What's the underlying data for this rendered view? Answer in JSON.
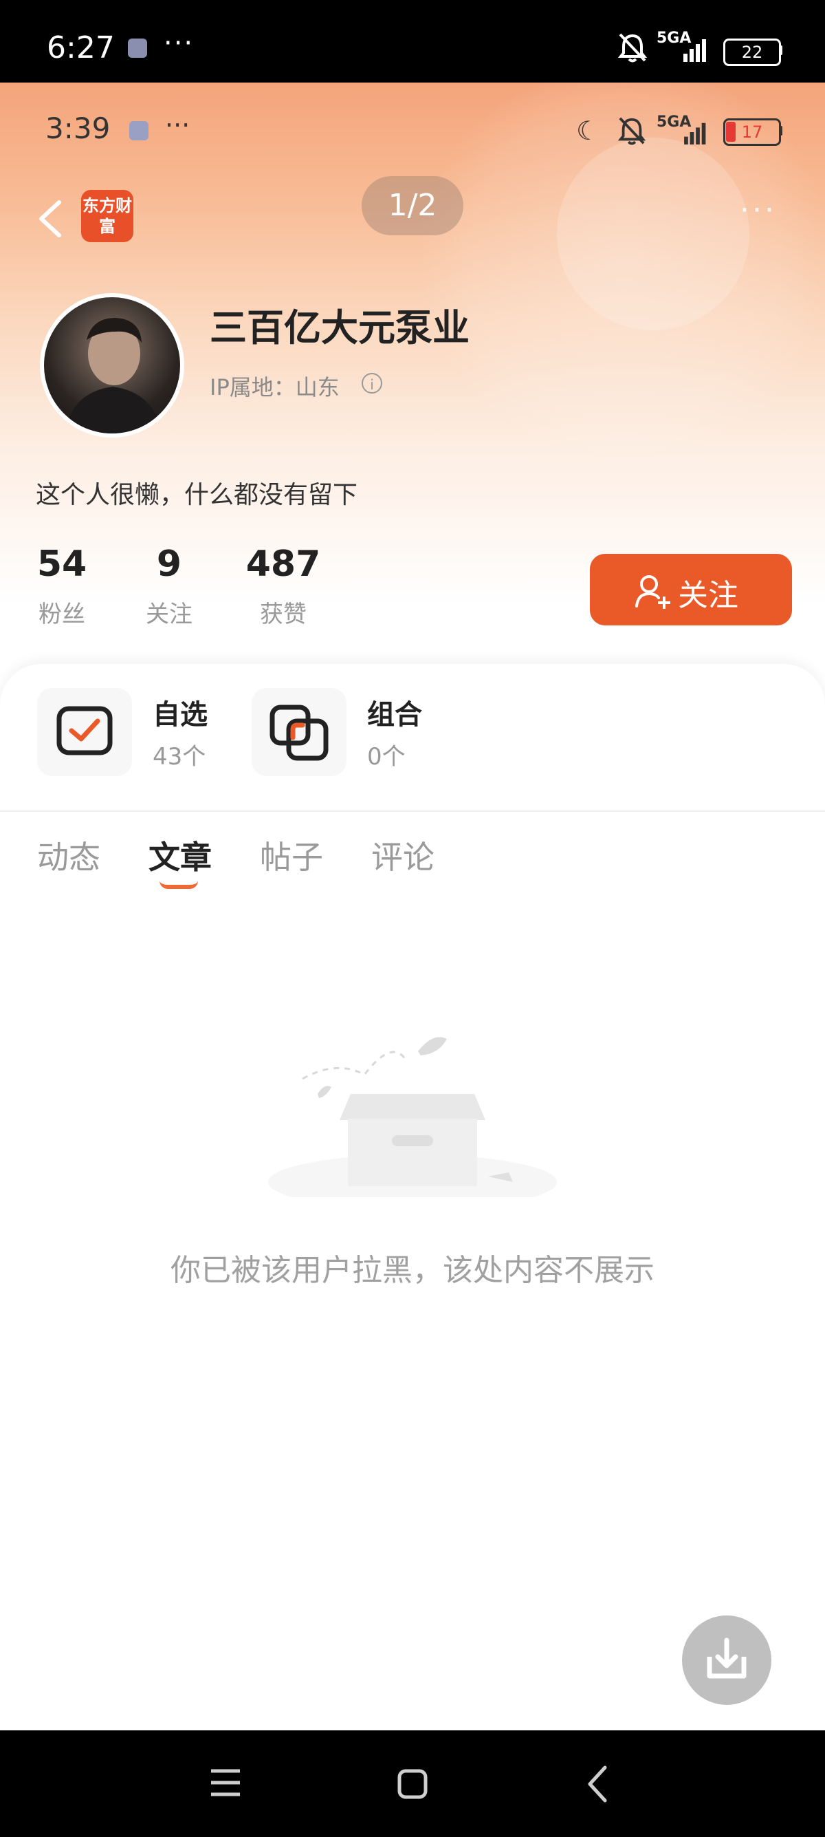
{
  "outer_status": {
    "time": "6:27",
    "dots": "···",
    "network": "5GA",
    "battery": "22"
  },
  "inner_status": {
    "time": "3:39",
    "dots": "···",
    "network": "5GA",
    "battery": "17"
  },
  "nav": {
    "logo_text": "东方财富",
    "page_indicator": "1/2",
    "more": "···"
  },
  "profile": {
    "username": "三百亿大元泵业",
    "ip_location": "IP属地：山东",
    "bio": "这个人很懒，什么都没有留下",
    "stats": [
      {
        "value": "54",
        "label": "粉丝"
      },
      {
        "value": "9",
        "label": "关注"
      },
      {
        "value": "487",
        "label": "获赞"
      }
    ],
    "follow_label": "关注"
  },
  "tools": [
    {
      "title": "自选",
      "count": "43个"
    },
    {
      "title": "组合",
      "count": "0个"
    }
  ],
  "tabs": [
    {
      "label": "动态",
      "active": false
    },
    {
      "label": "文章",
      "active": true
    },
    {
      "label": "帖子",
      "active": false
    },
    {
      "label": "评论",
      "active": false
    }
  ],
  "empty_state": {
    "message": "你已被该用户拉黑，该处内容不展示"
  },
  "colors": {
    "accent": "#EA5A28",
    "header_top": "#F4A47A"
  },
  "icons": [
    "back-icon",
    "info-icon",
    "follow-user-icon",
    "watchlist-icon",
    "portfolio-icon",
    "download-icon",
    "menu-icon",
    "home-icon",
    "nav-back-icon"
  ]
}
